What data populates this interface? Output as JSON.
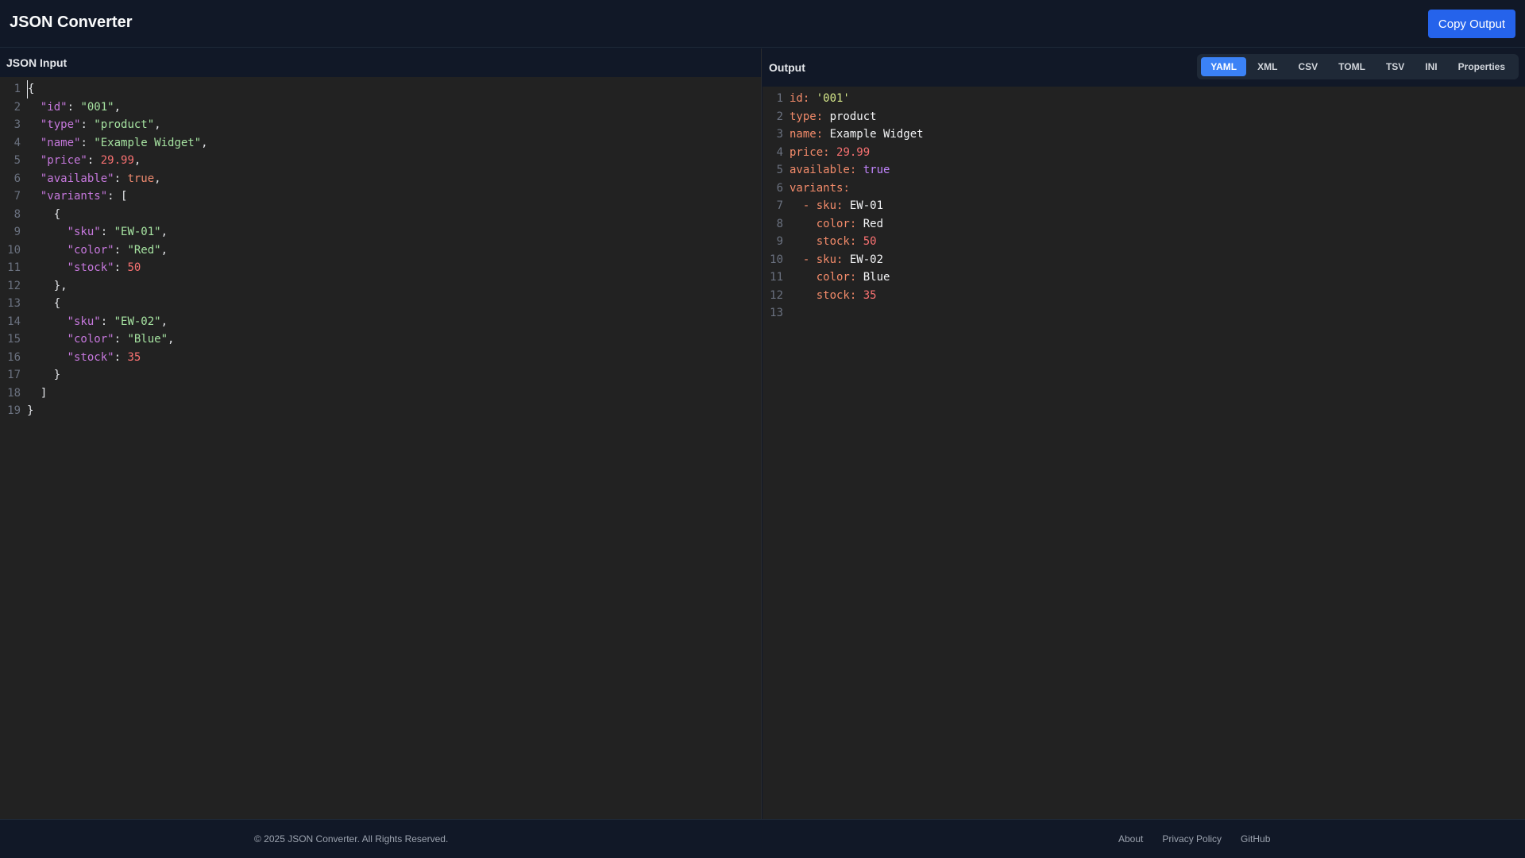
{
  "header": {
    "title": "JSON Converter",
    "copy_label": "Copy Output"
  },
  "input_panel": {
    "label": "JSON Input",
    "lines": [
      [
        {
          "t": "{",
          "c": "p"
        }
      ],
      [
        {
          "t": "  "
        },
        {
          "t": "\"id\"",
          "c": "k"
        },
        {
          "t": ": ",
          "c": "p"
        },
        {
          "t": "\"001\"",
          "c": "s"
        },
        {
          "t": ",",
          "c": "p"
        }
      ],
      [
        {
          "t": "  "
        },
        {
          "t": "\"type\"",
          "c": "k"
        },
        {
          "t": ": ",
          "c": "p"
        },
        {
          "t": "\"product\"",
          "c": "s"
        },
        {
          "t": ",",
          "c": "p"
        }
      ],
      [
        {
          "t": "  "
        },
        {
          "t": "\"name\"",
          "c": "k"
        },
        {
          "t": ": ",
          "c": "p"
        },
        {
          "t": "\"Example Widget\"",
          "c": "s"
        },
        {
          "t": ",",
          "c": "p"
        }
      ],
      [
        {
          "t": "  "
        },
        {
          "t": "\"price\"",
          "c": "k"
        },
        {
          "t": ": ",
          "c": "p"
        },
        {
          "t": "29.99",
          "c": "n"
        },
        {
          "t": ",",
          "c": "p"
        }
      ],
      [
        {
          "t": "  "
        },
        {
          "t": "\"available\"",
          "c": "k"
        },
        {
          "t": ": ",
          "c": "p"
        },
        {
          "t": "true",
          "c": "b"
        },
        {
          "t": ",",
          "c": "p"
        }
      ],
      [
        {
          "t": "  "
        },
        {
          "t": "\"variants\"",
          "c": "k"
        },
        {
          "t": ": [",
          "c": "p"
        }
      ],
      [
        {
          "t": "    {",
          "c": "p"
        }
      ],
      [
        {
          "t": "      "
        },
        {
          "t": "\"sku\"",
          "c": "k"
        },
        {
          "t": ": ",
          "c": "p"
        },
        {
          "t": "\"EW-01\"",
          "c": "s"
        },
        {
          "t": ",",
          "c": "p"
        }
      ],
      [
        {
          "t": "      "
        },
        {
          "t": "\"color\"",
          "c": "k"
        },
        {
          "t": ": ",
          "c": "p"
        },
        {
          "t": "\"Red\"",
          "c": "s"
        },
        {
          "t": ",",
          "c": "p"
        }
      ],
      [
        {
          "t": "      "
        },
        {
          "t": "\"stock\"",
          "c": "k"
        },
        {
          "t": ": ",
          "c": "p"
        },
        {
          "t": "50",
          "c": "n"
        }
      ],
      [
        {
          "t": "    },",
          "c": "p"
        }
      ],
      [
        {
          "t": "    {",
          "c": "p"
        }
      ],
      [
        {
          "t": "      "
        },
        {
          "t": "\"sku\"",
          "c": "k"
        },
        {
          "t": ": ",
          "c": "p"
        },
        {
          "t": "\"EW-02\"",
          "c": "s"
        },
        {
          "t": ",",
          "c": "p"
        }
      ],
      [
        {
          "t": "      "
        },
        {
          "t": "\"color\"",
          "c": "k"
        },
        {
          "t": ": ",
          "c": "p"
        },
        {
          "t": "\"Blue\"",
          "c": "s"
        },
        {
          "t": ",",
          "c": "p"
        }
      ],
      [
        {
          "t": "      "
        },
        {
          "t": "\"stock\"",
          "c": "k"
        },
        {
          "t": ": ",
          "c": "p"
        },
        {
          "t": "35",
          "c": "n"
        }
      ],
      [
        {
          "t": "    }",
          "c": "p"
        }
      ],
      [
        {
          "t": "  ]",
          "c": "p"
        }
      ],
      [
        {
          "t": "}",
          "c": "p"
        }
      ]
    ]
  },
  "output_panel": {
    "label": "Output",
    "tabs": [
      "YAML",
      "XML",
      "CSV",
      "TOML",
      "TSV",
      "INI",
      "Properties"
    ],
    "active_tab": "YAML",
    "lines": [
      [
        {
          "t": "id",
          "c": "yk"
        },
        {
          "t": ": ",
          "c": "yk"
        },
        {
          "t": "'001'",
          "c": "ys"
        }
      ],
      [
        {
          "t": "type",
          "c": "yk"
        },
        {
          "t": ": ",
          "c": "yk"
        },
        {
          "t": "product",
          "c": "yv"
        }
      ],
      [
        {
          "t": "name",
          "c": "yk"
        },
        {
          "t": ": ",
          "c": "yk"
        },
        {
          "t": "Example Widget",
          "c": "yv"
        }
      ],
      [
        {
          "t": "price",
          "c": "yk"
        },
        {
          "t": ": ",
          "c": "yk"
        },
        {
          "t": "29.99",
          "c": "yn"
        }
      ],
      [
        {
          "t": "available",
          "c": "yk"
        },
        {
          "t": ": ",
          "c": "yk"
        },
        {
          "t": "true",
          "c": "yb"
        }
      ],
      [
        {
          "t": "variants",
          "c": "yk"
        },
        {
          "t": ":",
          "c": "yk"
        }
      ],
      [
        {
          "t": "  - ",
          "c": "yk"
        },
        {
          "t": "sku",
          "c": "yk"
        },
        {
          "t": ": ",
          "c": "yk"
        },
        {
          "t": "EW-01",
          "c": "yv"
        }
      ],
      [
        {
          "t": "    "
        },
        {
          "t": "color",
          "c": "yk"
        },
        {
          "t": ": ",
          "c": "yk"
        },
        {
          "t": "Red",
          "c": "yv"
        }
      ],
      [
        {
          "t": "    "
        },
        {
          "t": "stock",
          "c": "yk"
        },
        {
          "t": ": ",
          "c": "yk"
        },
        {
          "t": "50",
          "c": "yn"
        }
      ],
      [
        {
          "t": "  - ",
          "c": "yk"
        },
        {
          "t": "sku",
          "c": "yk"
        },
        {
          "t": ": ",
          "c": "yk"
        },
        {
          "t": "EW-02",
          "c": "yv"
        }
      ],
      [
        {
          "t": "    "
        },
        {
          "t": "color",
          "c": "yk"
        },
        {
          "t": ": ",
          "c": "yk"
        },
        {
          "t": "Blue",
          "c": "yv"
        }
      ],
      [
        {
          "t": "    "
        },
        {
          "t": "stock",
          "c": "yk"
        },
        {
          "t": ": ",
          "c": "yk"
        },
        {
          "t": "35",
          "c": "yn"
        }
      ],
      []
    ]
  },
  "footer": {
    "copyright": "© 2025 JSON Converter. All Rights Reserved.",
    "links": [
      "About",
      "Privacy Policy",
      "GitHub"
    ]
  },
  "colors": {
    "accent": "#2563eb",
    "active_tab": "#3b82f6"
  }
}
